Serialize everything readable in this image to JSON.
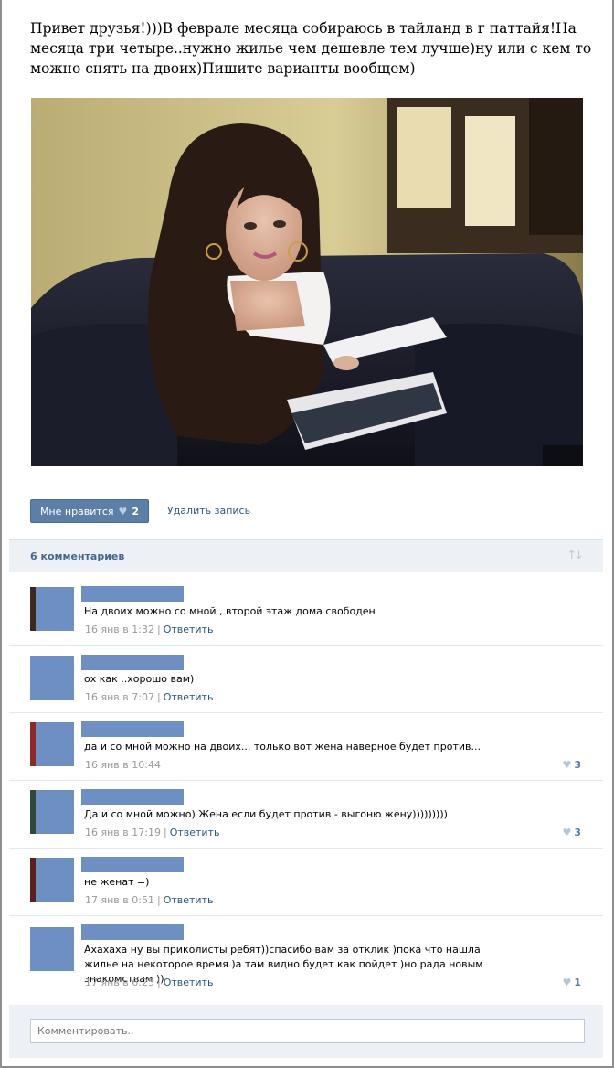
{
  "post": {
    "text": "Привет друзья!)))В феврале месяца собираюсь в тайланд в г паттайя!На месяца три четыре..нужно жилье чем дешевле тем лучше)ну или с кем то можно снять на двоих)Пишите варианты вообщем)"
  },
  "actions": {
    "like_label": "Мне нравится",
    "like_count": "2",
    "delete_label": "Удалить запись"
  },
  "comments_header": {
    "count_label": "6 комментариев"
  },
  "comments": [
    {
      "text": "На двоих можно со мной , второй этаж дома свободен",
      "date": "16 янв в 1:32",
      "reply": "Ответить",
      "likes": ""
    },
    {
      "text": "ох как ..хорошо вам)",
      "date": "16 янв в 7:07",
      "reply": "Ответить",
      "likes": ""
    },
    {
      "text": "да и со мной можно на двоих... только вот жена наверное будет против...",
      "date": "16 янв в 10:44",
      "reply": "",
      "likes": "3"
    },
    {
      "text": "Да и со мной можно) Жена если будет против - выгоню жену)))))))))",
      "date": "16 янв в 17:19",
      "reply": "Ответить",
      "likes": "3"
    },
    {
      "text": "не женат =)",
      "date": "17 янв в 0:51",
      "reply": "Ответить",
      "likes": ""
    },
    {
      "text": "Ахахаха ну вы приколисты ребят))спасибо вам за отклик )пока что нашла жилье на некоторое время )а там видно будет как пойдет )но рада новым знакомствам ))",
      "date": "17 янв в 6:25",
      "reply": "Ответить",
      "likes": "1"
    }
  ],
  "reply_box": {
    "placeholder": "Комментировать.."
  },
  "colors": {
    "accent": "#5b7fa6",
    "link": "#2b587a",
    "header_bg": "#edf1f5",
    "avatar_placeholder": "#6d8fc2"
  }
}
